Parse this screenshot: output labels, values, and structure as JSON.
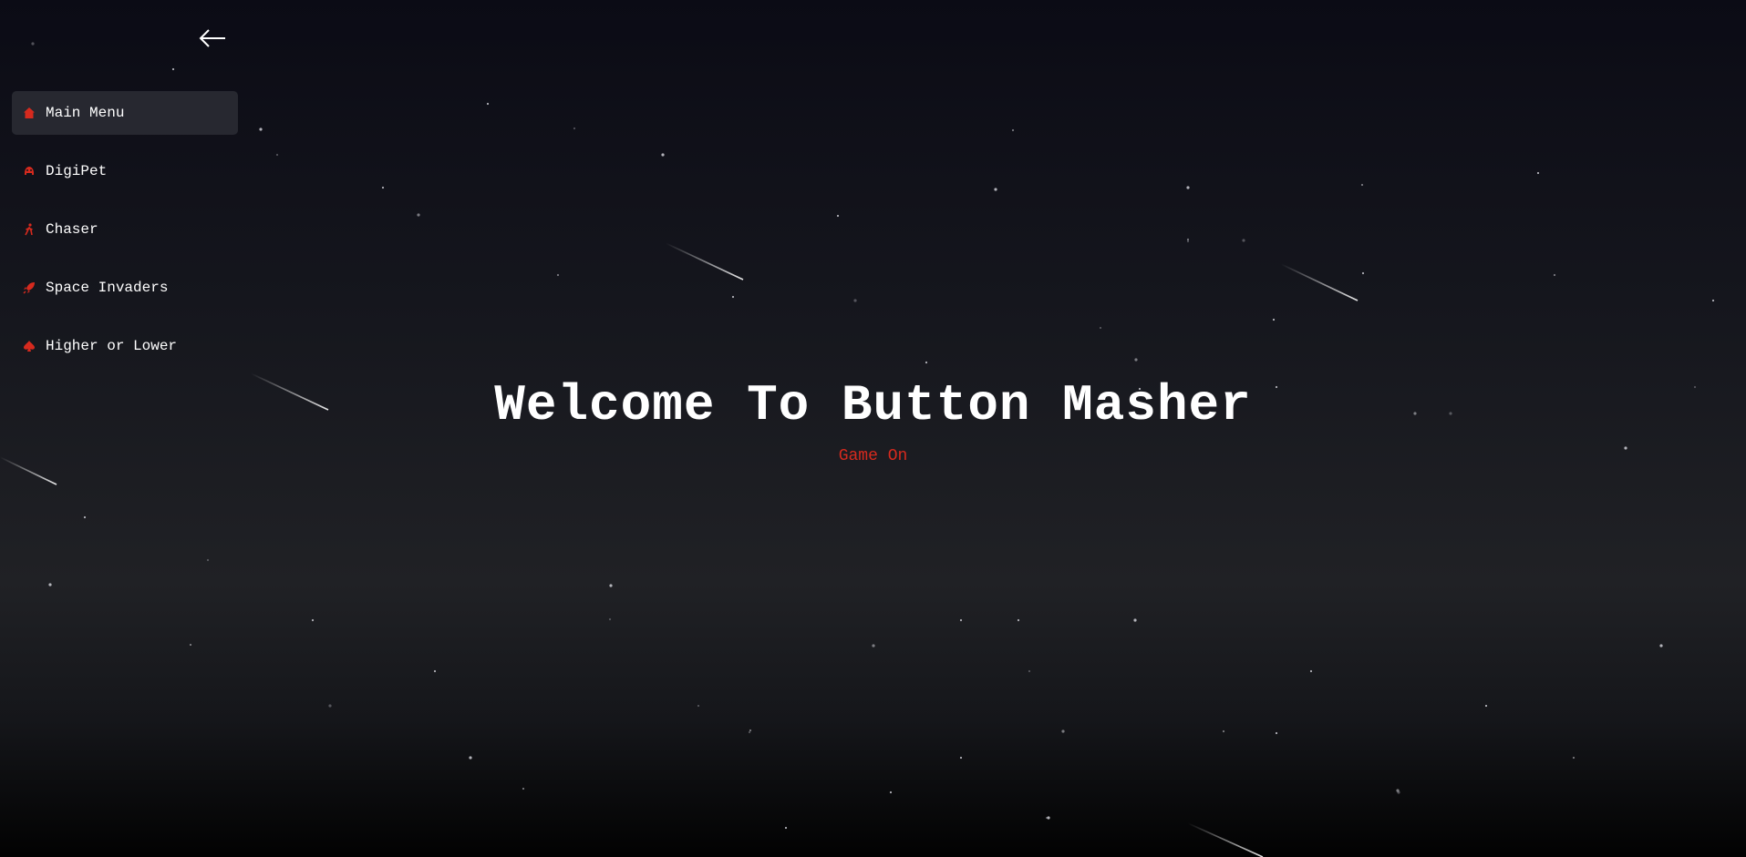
{
  "colors": {
    "accent": "#d62a1e",
    "text": "#ffffff",
    "active_item_bg": "#272830"
  },
  "back_button": {
    "icon": "arrow-left-icon"
  },
  "sidebar": {
    "items": [
      {
        "label": "Main Menu",
        "icon": "home-icon",
        "active": true
      },
      {
        "label": "DigiPet",
        "icon": "pet-icon",
        "active": false
      },
      {
        "label": "Chaser",
        "icon": "running-person-icon",
        "active": false
      },
      {
        "label": "Space Invaders",
        "icon": "rocket-icon",
        "active": false
      },
      {
        "label": "Higher or Lower",
        "icon": "spade-icon",
        "active": false
      }
    ]
  },
  "main": {
    "title": "Welcome To Button Masher",
    "subtitle": "Game On"
  }
}
